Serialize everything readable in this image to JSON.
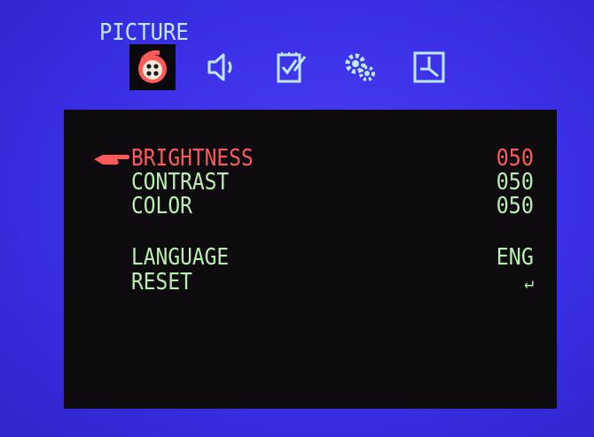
{
  "menu": {
    "title": "PICTURE",
    "tabs": [
      {
        "icon": "picture-icon",
        "active": true
      },
      {
        "icon": "speaker-icon",
        "active": false
      },
      {
        "icon": "setup-icon",
        "active": false
      },
      {
        "icon": "settings-gears-icon",
        "active": false
      },
      {
        "icon": "clock-icon",
        "active": false
      }
    ]
  },
  "items": [
    {
      "label": "BRIGHTNESS",
      "value": "050",
      "selected": true
    },
    {
      "label": "CONTRAST",
      "value": "050",
      "selected": false
    },
    {
      "label": "COLOR",
      "value": "050",
      "selected": false
    },
    {
      "label": "LANGUAGE",
      "value": "ENG",
      "selected": false
    },
    {
      "label": "RESET",
      "value": "↵",
      "selected": false
    }
  ],
  "colors": {
    "background": "#3a2fe0",
    "panel": "#0d0b0d",
    "text": "#b9efb0",
    "selected": "#ff5a5a",
    "title": "#bfe8ff"
  }
}
